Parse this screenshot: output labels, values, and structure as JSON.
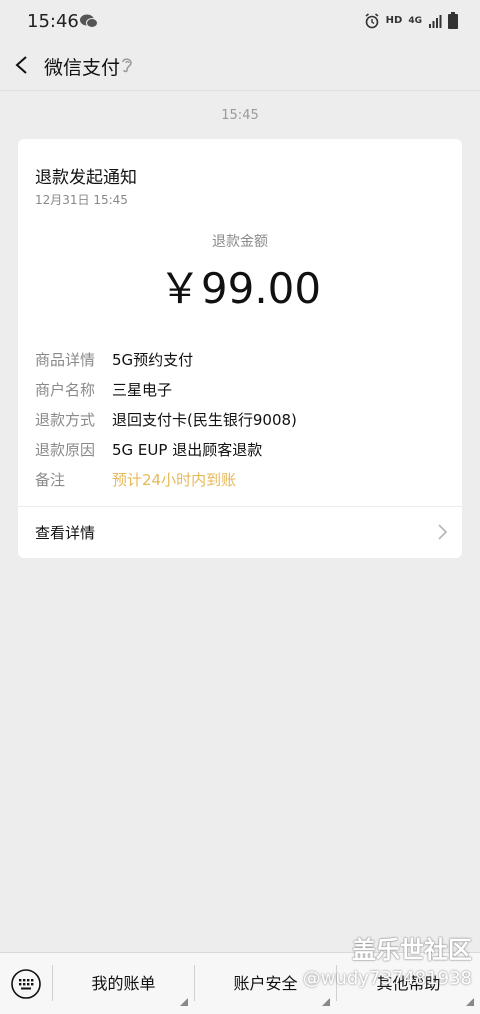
{
  "status_bar": {
    "time": "15:46",
    "network": "HD",
    "signal": "4G"
  },
  "header": {
    "title": "微信支付"
  },
  "timestamp": "15:45",
  "card": {
    "title": "退款发起通知",
    "date": "12月31日  15:45",
    "amount_label": "退款金额",
    "amount": "￥99.00",
    "rows": [
      {
        "label": "商品详情",
        "value": "5G预约支付"
      },
      {
        "label": "商户名称",
        "value": "三星电子"
      },
      {
        "label": "退款方式",
        "value": "退回支付卡(民生银行9008)"
      },
      {
        "label": "退款原因",
        "value": "5G EUP 退出顾客退款"
      },
      {
        "label": "备注",
        "value": "预计24小时内到账"
      }
    ],
    "detail_label": "查看详情"
  },
  "bottom_bar": {
    "items": [
      "我的账单",
      "账户安全",
      "其他帮助"
    ]
  },
  "watermark": {
    "title": "盖乐世社区",
    "user": "@wudy737481938"
  },
  "colors": {
    "highlight": "#e6b95a",
    "background": "#ededed"
  }
}
